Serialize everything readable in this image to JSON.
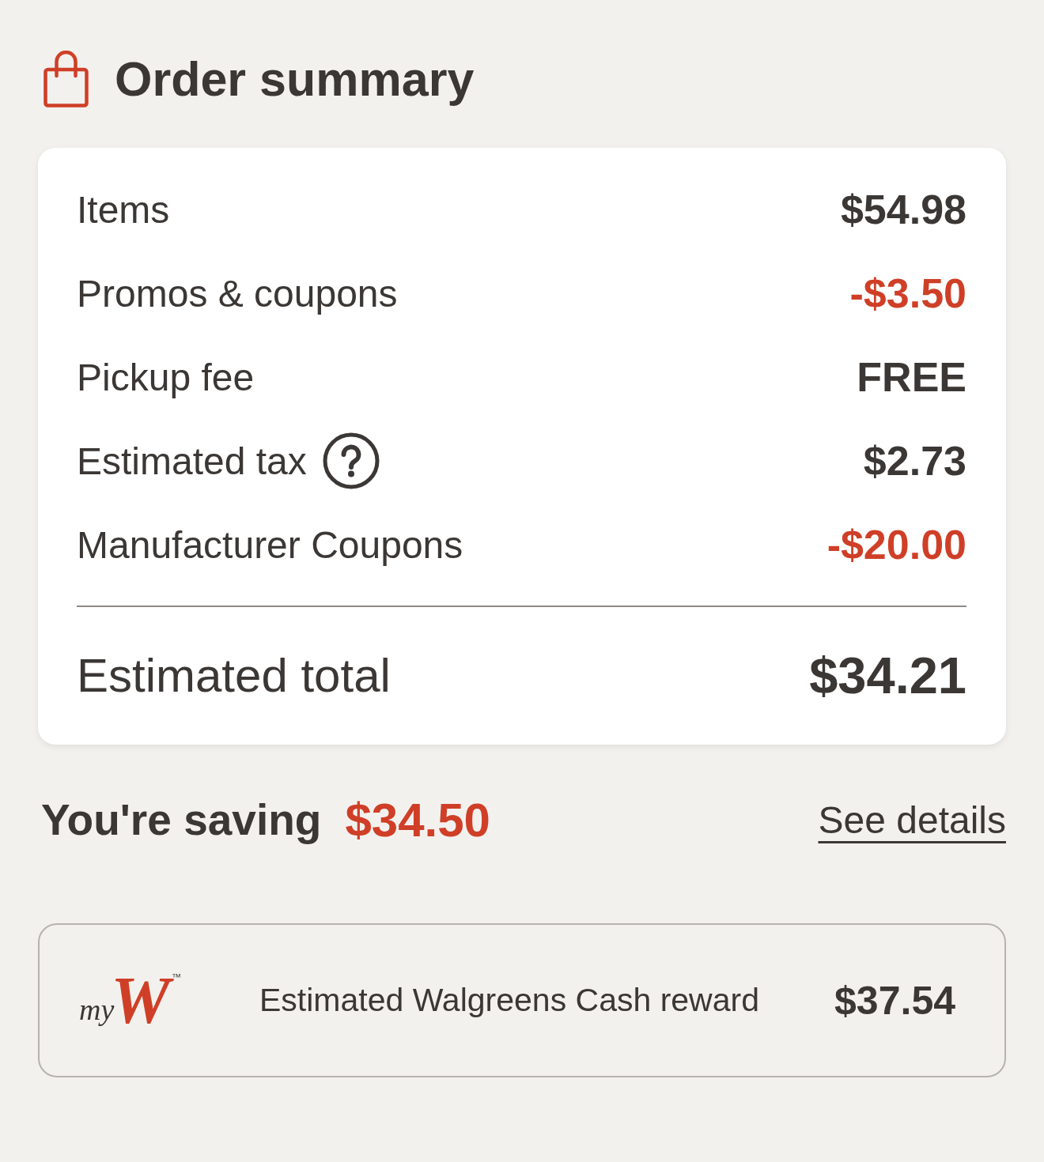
{
  "header": {
    "title": "Order summary"
  },
  "summary": {
    "rows": [
      {
        "label": "Items",
        "value": "$54.98",
        "kind": "amount",
        "help": false
      },
      {
        "label": "Promos & coupons",
        "value": "-$3.50",
        "kind": "discount",
        "help": false
      },
      {
        "label": "Pickup fee",
        "value": "FREE",
        "kind": "amount",
        "help": false
      },
      {
        "label": "Estimated tax",
        "value": "$2.73",
        "kind": "amount",
        "help": true
      },
      {
        "label": "Manufacturer Coupons",
        "value": "-$20.00",
        "kind": "discount",
        "help": false
      }
    ],
    "total": {
      "label": "Estimated total",
      "value": "$34.21"
    }
  },
  "savings": {
    "label": "You're saving",
    "amount": "$34.50",
    "link": "See details"
  },
  "rewards": {
    "logo": {
      "prefix": "my",
      "mark": "W",
      "trademark": "™"
    },
    "label": "Estimated Walgreens Cash reward",
    "value": "$37.54"
  }
}
